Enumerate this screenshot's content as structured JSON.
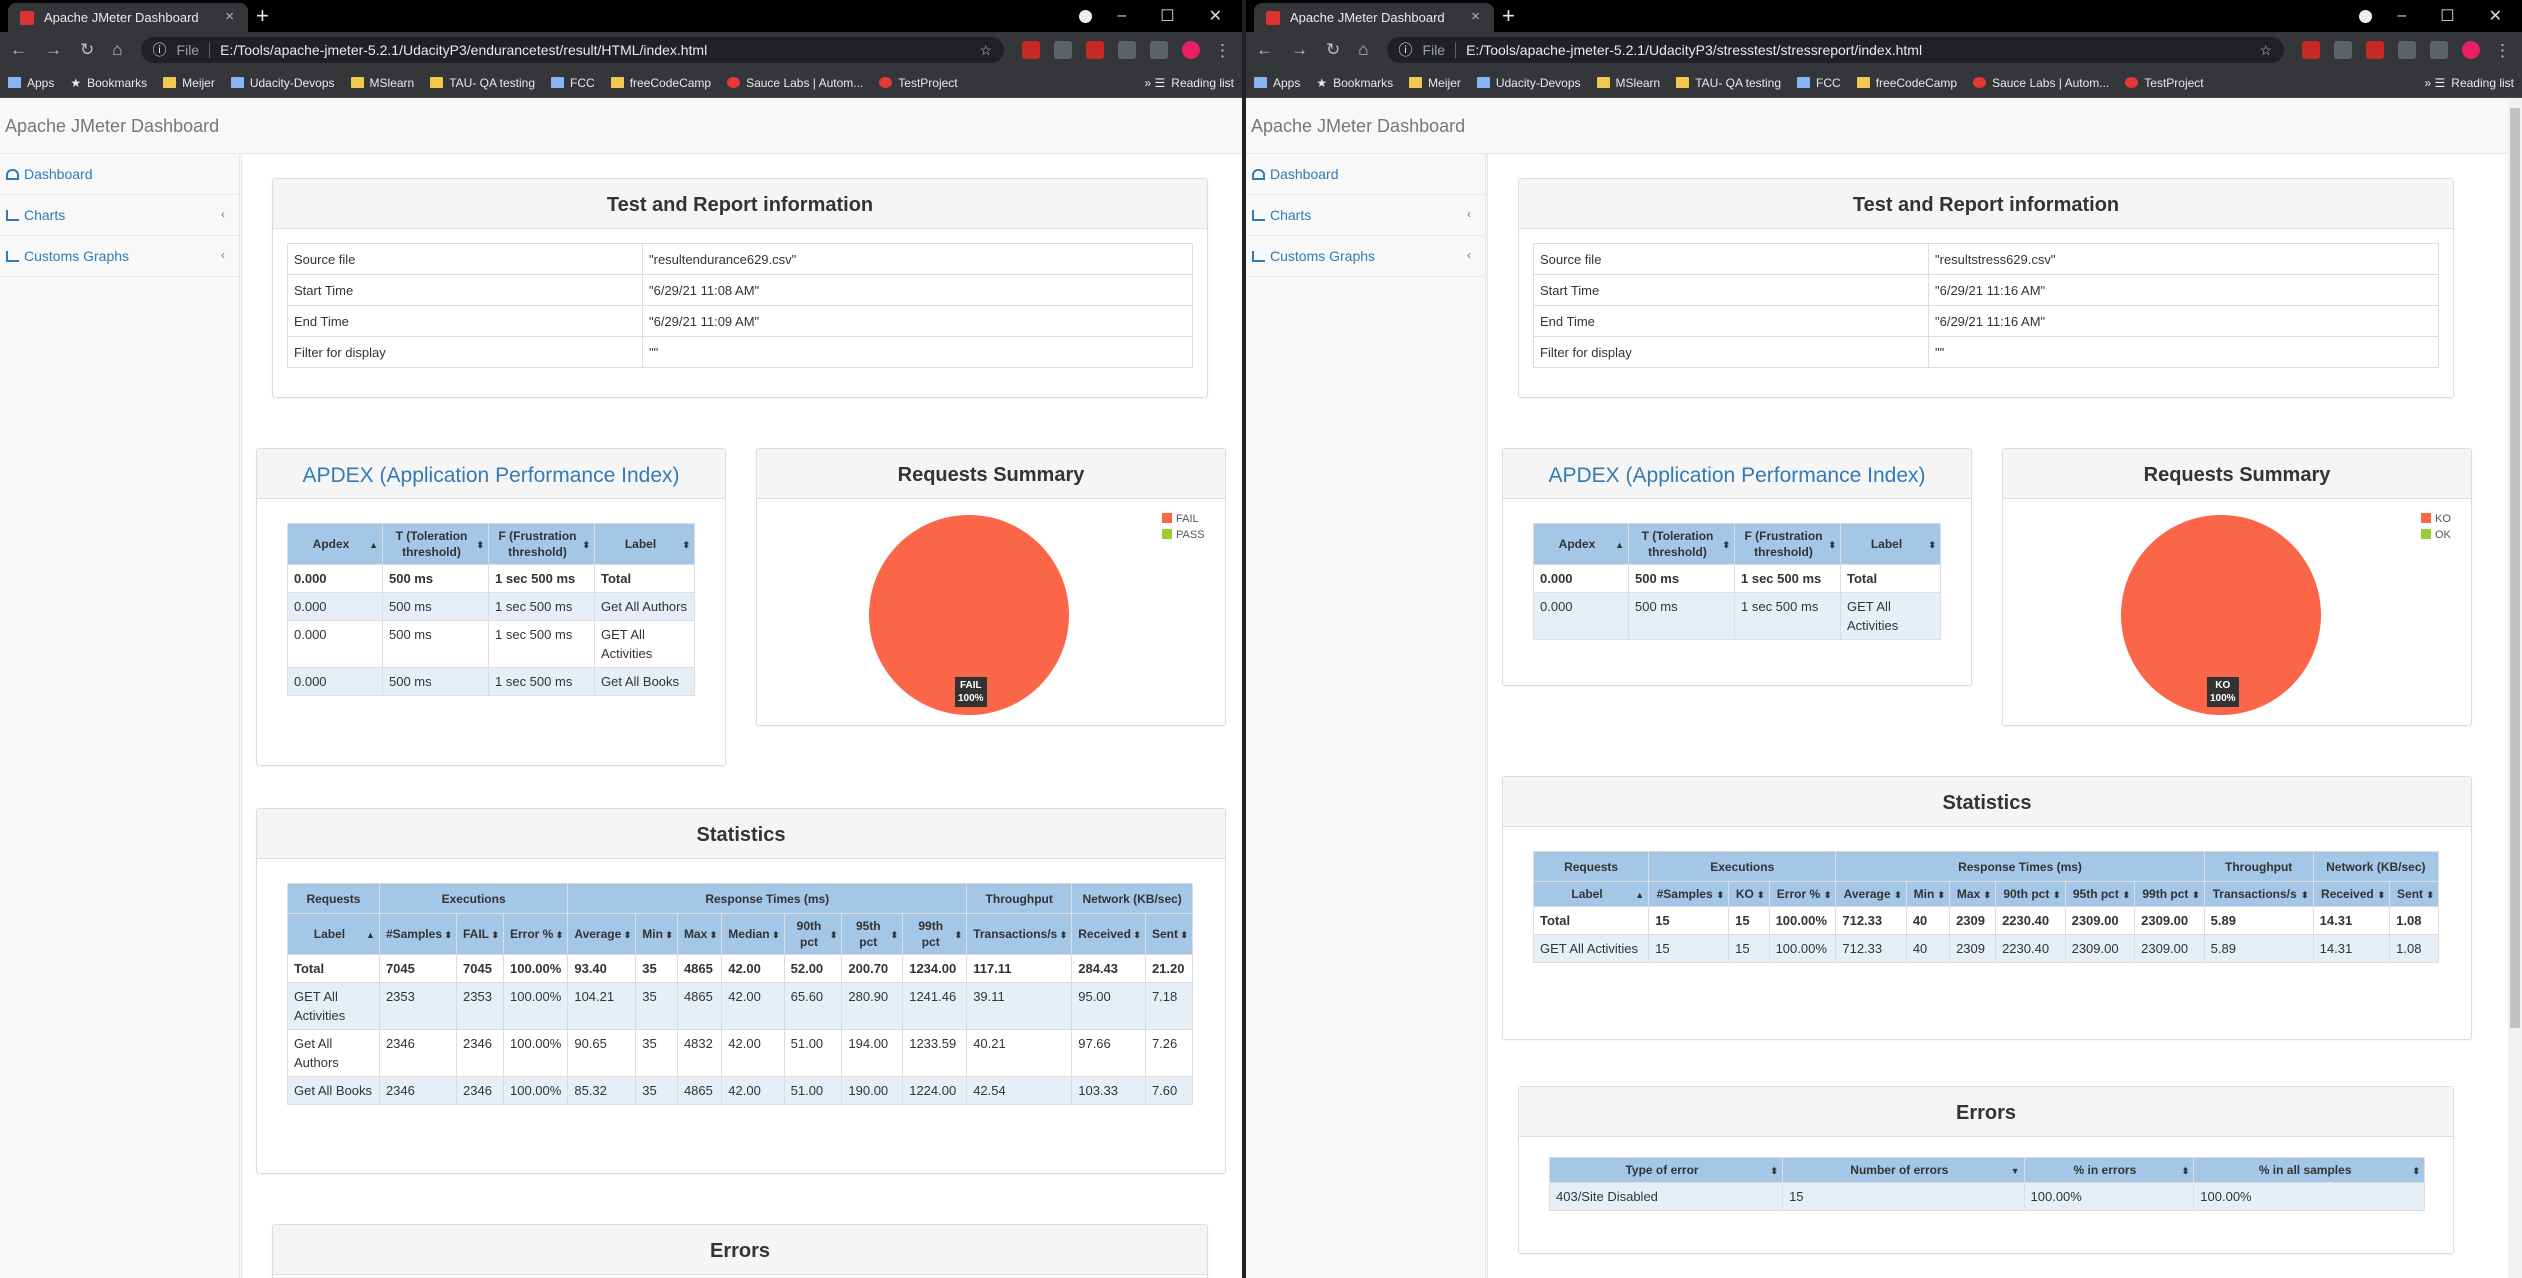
{
  "left": {
    "tab_title": "Apache JMeter Dashboard",
    "url": "E:/Tools/apache-jmeter-5.2.1/UdacityP3/endurancetest/result/HTML/index.html",
    "file_label": "File",
    "bookmarks": [
      "Apps",
      "Bookmarks",
      "Meijer",
      "Udacity-Devops",
      "MSlearn",
      "TAU- QA testing",
      "FCC",
      "freeCodeCamp",
      "Sauce Labs | Autom...",
      "TestProject"
    ],
    "reading_list": "Reading list",
    "header": "Apache JMeter Dashboard",
    "nav": [
      "Dashboard",
      "Charts",
      "Customs Graphs"
    ],
    "report_title": "Test and Report information",
    "info": [
      [
        "Source file",
        "\"resultendurance629.csv\""
      ],
      [
        "Start Time",
        "\"6/29/21 11:08 AM\""
      ],
      [
        "End Time",
        "\"6/29/21 11:09 AM\""
      ],
      [
        "Filter for display",
        "\"\""
      ]
    ],
    "apdex_title": "APDEX (Application Performance Index)",
    "apdex_headers": [
      "Apdex",
      "T (Toleration threshold)",
      "F (Frustration threshold)",
      "Label"
    ],
    "apdex_rows": [
      [
        "0.000",
        "500 ms",
        "1 sec 500 ms",
        "Total"
      ],
      [
        "0.000",
        "500 ms",
        "1 sec 500 ms",
        "Get All Authors"
      ],
      [
        "0.000",
        "500 ms",
        "1 sec 500 ms",
        "GET All Activities"
      ],
      [
        "0.000",
        "500 ms",
        "1 sec 500 ms",
        "Get All Books"
      ]
    ],
    "summary_title": "Requests Summary",
    "legend": [
      "FAIL",
      "PASS"
    ],
    "pie_label": "FAIL",
    "pie_pct": "100%",
    "stats_title": "Statistics",
    "stats_groups": [
      "Requests",
      "Executions",
      "Response Times (ms)",
      "Throughput",
      "Network (KB/sec)"
    ],
    "stats_headers": [
      "Label",
      "#Samples",
      "FAIL",
      "Error %",
      "Average",
      "Min",
      "Max",
      "Median",
      "90th pct",
      "95th pct",
      "99th pct",
      "Transactions/s",
      "Received",
      "Sent"
    ],
    "stats_rows": [
      [
        "Total",
        "7045",
        "7045",
        "100.00%",
        "93.40",
        "35",
        "4865",
        "42.00",
        "52.00",
        "200.70",
        "1234.00",
        "117.11",
        "284.43",
        "21.20"
      ],
      [
        "GET All Activities",
        "2353",
        "2353",
        "100.00%",
        "104.21",
        "35",
        "4865",
        "42.00",
        "65.60",
        "280.90",
        "1241.46",
        "39.11",
        "95.00",
        "7.18"
      ],
      [
        "Get All Authors",
        "2346",
        "2346",
        "100.00%",
        "90.65",
        "35",
        "4832",
        "42.00",
        "51.00",
        "194.00",
        "1233.59",
        "40.21",
        "97.66",
        "7.26"
      ],
      [
        "Get All Books",
        "2346",
        "2346",
        "100.00%",
        "85.32",
        "35",
        "4865",
        "42.00",
        "51.00",
        "190.00",
        "1224.00",
        "42.54",
        "103.33",
        "7.60"
      ]
    ],
    "errors_title": "Errors"
  },
  "right": {
    "tab_title": "Apache JMeter Dashboard",
    "url": "E:/Tools/apache-jmeter-5.2.1/UdacityP3/stresstest/stressreport/index.html",
    "file_label": "File",
    "bookmarks": [
      "Apps",
      "Bookmarks",
      "Meijer",
      "Udacity-Devops",
      "MSlearn",
      "TAU- QA testing",
      "FCC",
      "freeCodeCamp",
      "Sauce Labs | Autom...",
      "TestProject"
    ],
    "reading_list": "Reading list",
    "header": "Apache JMeter Dashboard",
    "nav": [
      "Dashboard",
      "Charts",
      "Customs Graphs"
    ],
    "report_title": "Test and Report information",
    "info": [
      [
        "Source file",
        "\"resultstress629.csv\""
      ],
      [
        "Start Time",
        "\"6/29/21 11:16 AM\""
      ],
      [
        "End Time",
        "\"6/29/21 11:16 AM\""
      ],
      [
        "Filter for display",
        "\"\""
      ]
    ],
    "apdex_title": "APDEX (Application Performance Index)",
    "apdex_headers": [
      "Apdex",
      "T (Toleration threshold)",
      "F (Frustration threshold)",
      "Label"
    ],
    "apdex_rows": [
      [
        "0.000",
        "500 ms",
        "1 sec 500 ms",
        "Total"
      ],
      [
        "0.000",
        "500 ms",
        "1 sec 500 ms",
        "GET All Activities"
      ]
    ],
    "summary_title": "Requests Summary",
    "legend": [
      "KO",
      "OK"
    ],
    "pie_label": "KO",
    "pie_pct": "100%",
    "stats_title": "Statistics",
    "stats_groups": [
      "Requests",
      "Executions",
      "Response Times (ms)",
      "Throughput",
      "Network (KB/sec)"
    ],
    "stats_headers": [
      "Label",
      "#Samples",
      "KO",
      "Error %",
      "Average",
      "Min",
      "Max",
      "90th pct",
      "95th pct",
      "99th pct",
      "Transactions/s",
      "Received",
      "Sent"
    ],
    "stats_rows": [
      [
        "Total",
        "15",
        "15",
        "100.00%",
        "712.33",
        "40",
        "2309",
        "2230.40",
        "2309.00",
        "2309.00",
        "5.89",
        "14.31",
        "1.08"
      ],
      [
        "GET All Activities",
        "15",
        "15",
        "100.00%",
        "712.33",
        "40",
        "2309",
        "2230.40",
        "2309.00",
        "2309.00",
        "5.89",
        "14.31",
        "1.08"
      ]
    ],
    "errors_title": "Errors",
    "errors_headers": [
      "Type of error",
      "Number of errors",
      "% in errors",
      "% in all samples"
    ],
    "errors_rows": [
      [
        "403/Site Disabled",
        "15",
        "100.00%",
        "100.00%"
      ]
    ]
  },
  "colors": {
    "fail": "#fb6548",
    "pass": "#9acd32",
    "header_blue": "#a4c7e8",
    "link": "#337ab7"
  }
}
